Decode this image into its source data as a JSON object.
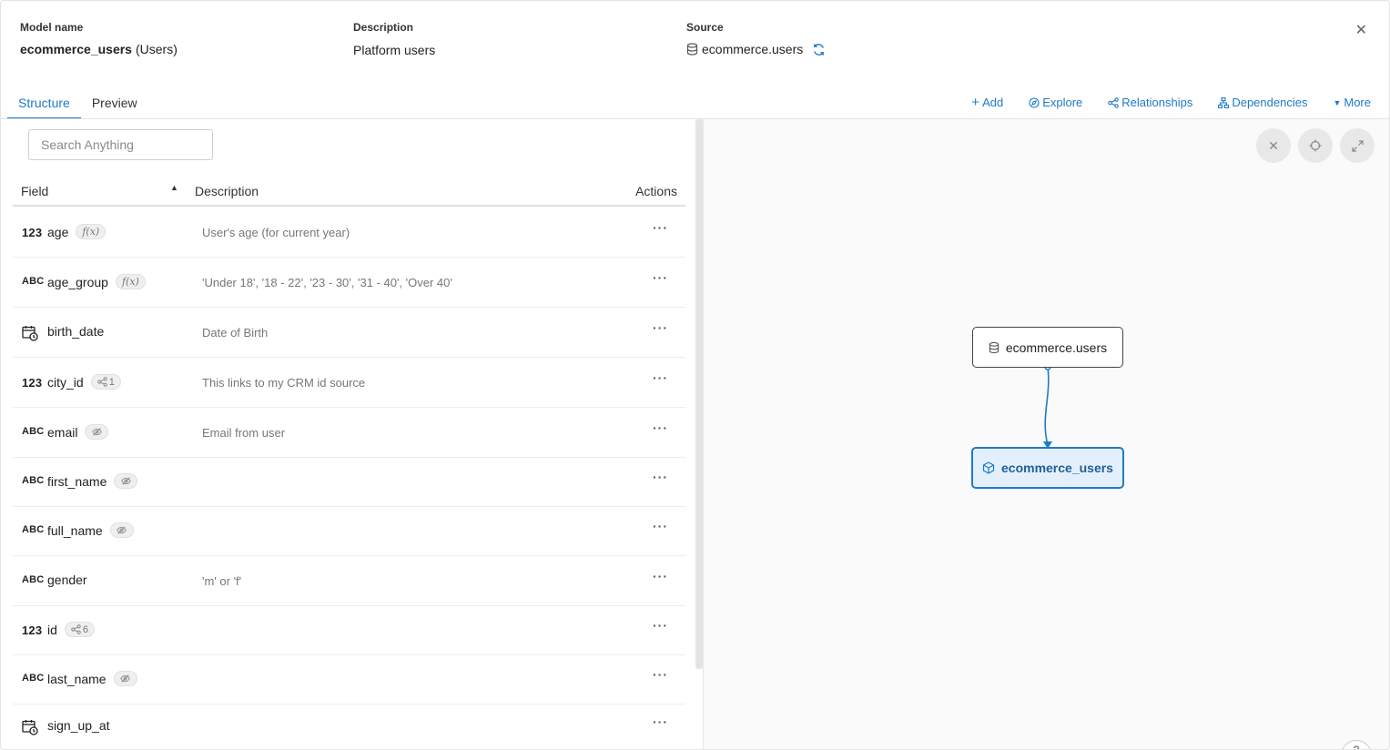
{
  "header": {
    "model_label": "Model name",
    "model_name": "ecommerce_users",
    "model_alias": "(Users)",
    "description_label": "Description",
    "description": "Platform users",
    "source_label": "Source",
    "source": "ecommerce.users"
  },
  "tabs": [
    {
      "label": "Structure",
      "active": true
    },
    {
      "label": "Preview",
      "active": false
    }
  ],
  "toolbar": {
    "add": "Add",
    "explore": "Explore",
    "relationships": "Relationships",
    "dependencies": "Dependencies",
    "more": "More"
  },
  "search": {
    "placeholder": "Search Anything"
  },
  "table": {
    "columns": {
      "field": "Field",
      "description": "Description",
      "actions": "Actions"
    },
    "rows": [
      {
        "type": "123",
        "name": "age",
        "badge": "f(x)",
        "description": "User's age (for current year)"
      },
      {
        "type": "ABC",
        "name": "age_group",
        "badge": "f(x)",
        "description": "'Under 18', '18 - 22', '23 - 30', '31 - 40', 'Over 40'"
      },
      {
        "type": "date-icon",
        "name": "birth_date",
        "badge": "",
        "description": "Date of Birth"
      },
      {
        "type": "123",
        "name": "city_id",
        "badge": "1",
        "description": "This links to my CRM id source"
      },
      {
        "type": "ABC",
        "name": "email",
        "badge": "hidden-icon",
        "description": "Email from user"
      },
      {
        "type": "ABC",
        "name": "first_name",
        "badge": "hidden-icon",
        "description": ""
      },
      {
        "type": "ABC",
        "name": "full_name",
        "badge": "hidden-icon",
        "description": ""
      },
      {
        "type": "ABC",
        "name": "gender",
        "badge": "",
        "description": "'m' or 'f'"
      },
      {
        "type": "123",
        "name": "id",
        "badge": "6",
        "description": ""
      },
      {
        "type": "ABC",
        "name": "last_name",
        "badge": "hidden-icon",
        "description": ""
      },
      {
        "type": "date-icon",
        "name": "sign_up_at",
        "badge": "",
        "description": ""
      }
    ],
    "row_action": "···"
  },
  "graph": {
    "source_node": "ecommerce.users",
    "model_node": "ecommerce_users",
    "help": "?"
  },
  "colors": {
    "accent": "#1f7ac8",
    "node_fill": "#e3f0fb"
  }
}
